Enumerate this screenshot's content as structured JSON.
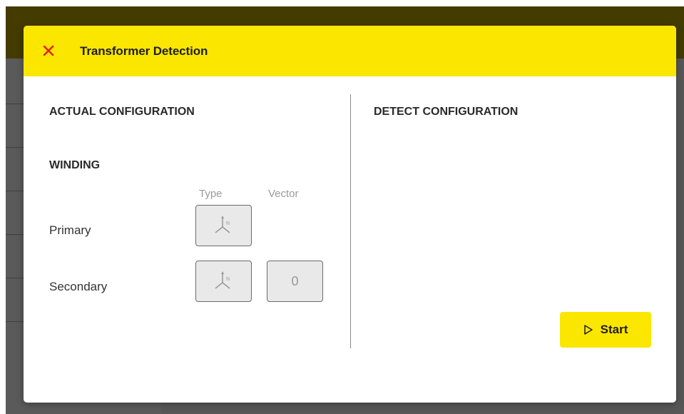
{
  "modal": {
    "title": "Transformer Detection",
    "close_icon": "close-icon",
    "accent_color": "#fbe600",
    "close_color": "#e2231a"
  },
  "actual": {
    "heading": "ACTUAL CONFIGURATION",
    "subheading": "WINDING",
    "columns": {
      "type": "Type",
      "vector": "Vector"
    },
    "rows": [
      {
        "label": "Primary",
        "type_icon": "wye-neutral-icon"
      },
      {
        "label": "Secondary",
        "type_icon": "wye-neutral-icon",
        "vector": "0"
      }
    ]
  },
  "detect": {
    "heading": "DETECT CONFIGURATION",
    "start_label": "Start",
    "start_icon": "play-icon"
  }
}
